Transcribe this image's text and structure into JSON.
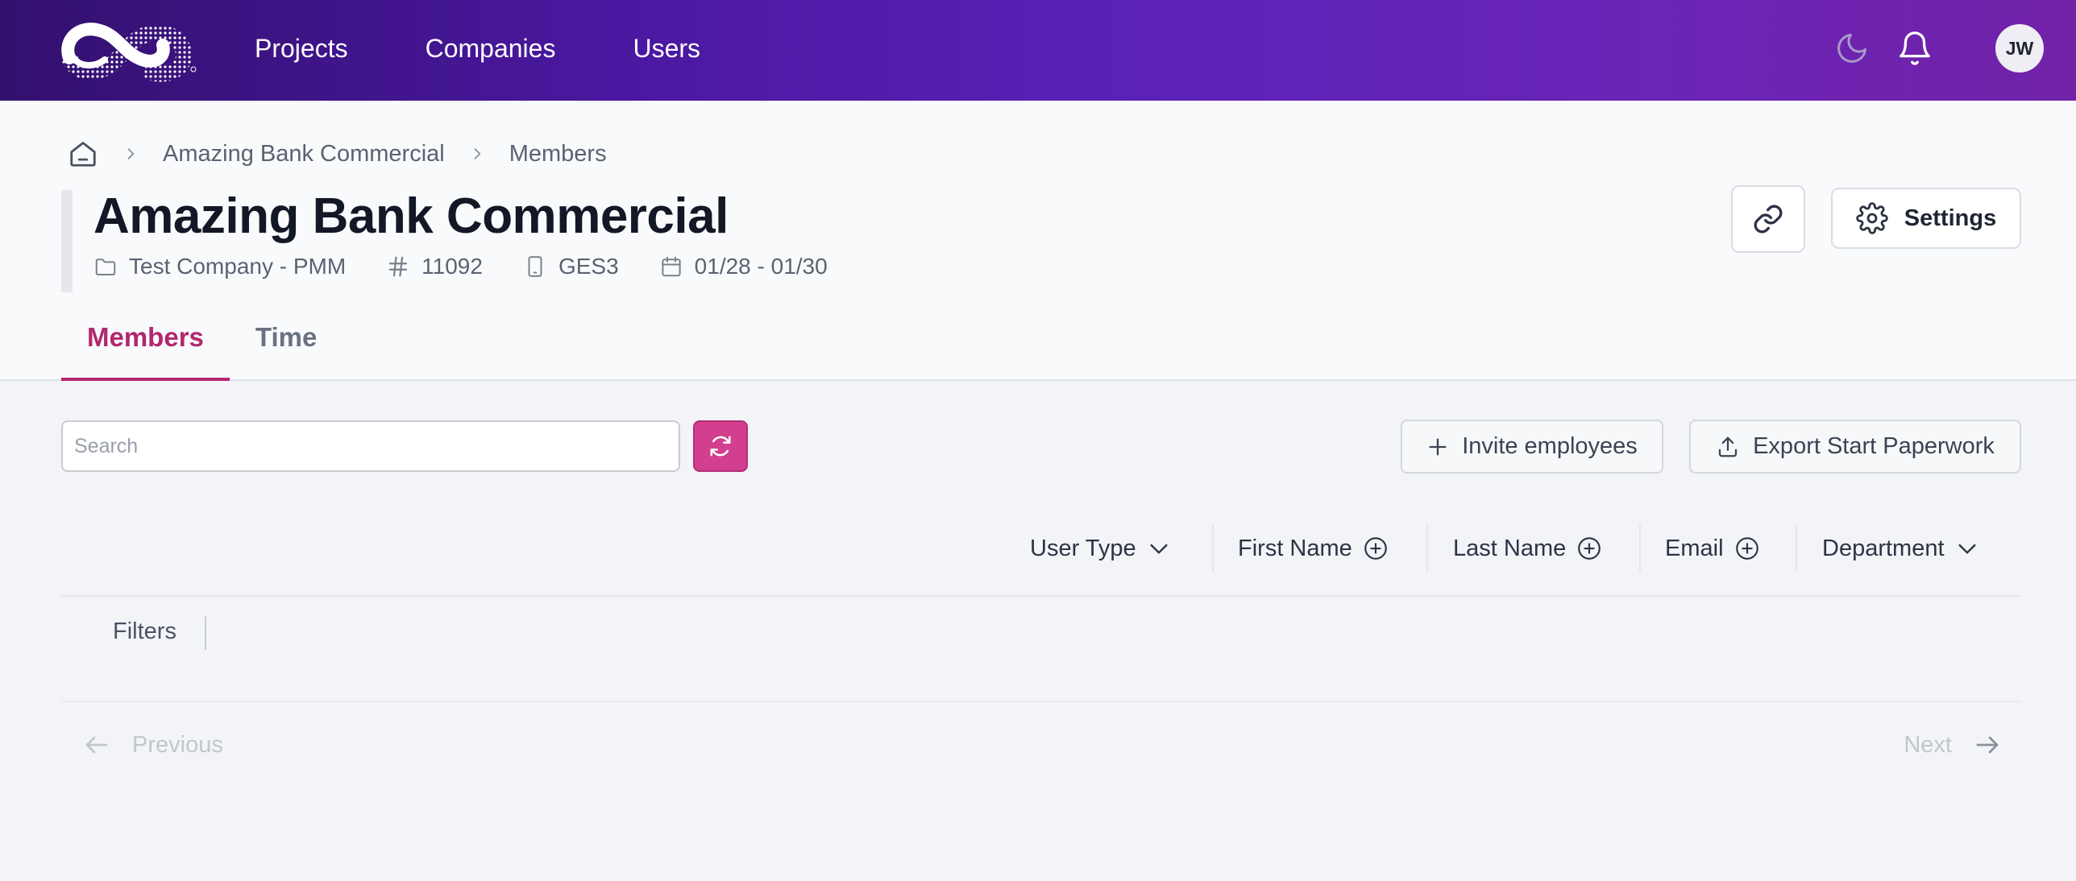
{
  "nav": {
    "items": [
      "Projects",
      "Companies",
      "Users"
    ],
    "avatar_initials": "JW",
    "icons": [
      "moon-icon",
      "bell-icon"
    ]
  },
  "breadcrumb": {
    "items": [
      "Amazing Bank Commercial",
      "Members"
    ]
  },
  "header": {
    "title": "Amazing Bank Commercial",
    "meta": {
      "company": "Test Company - PMM",
      "number": "11092",
      "code": "GES3",
      "dates": "01/28 - 01/30"
    },
    "settings_label": "Settings"
  },
  "tabs": [
    {
      "label": "Members",
      "active": true
    },
    {
      "label": "Time",
      "active": false
    }
  ],
  "toolbar": {
    "search_placeholder": "Search",
    "search_value": "",
    "invite_label": "Invite employees",
    "export_label": "Export Start Paperwork"
  },
  "columns": [
    {
      "label": "User Type",
      "icon": "chevron-down-icon"
    },
    {
      "label": "First Name",
      "icon": "plus-circle-icon"
    },
    {
      "label": "Last Name",
      "icon": "plus-circle-icon"
    },
    {
      "label": "Email",
      "icon": "plus-circle-icon"
    },
    {
      "label": "Department",
      "icon": "chevron-down-icon"
    }
  ],
  "filters_label": "Filters",
  "pager": {
    "prev_label": "Previous",
    "next_label": "Next"
  },
  "colors": {
    "accent": "#b2276f",
    "refresh_button": "#d23f8f",
    "nav_gradient_start": "#33106e",
    "nav_gradient_end": "#7222a8"
  }
}
